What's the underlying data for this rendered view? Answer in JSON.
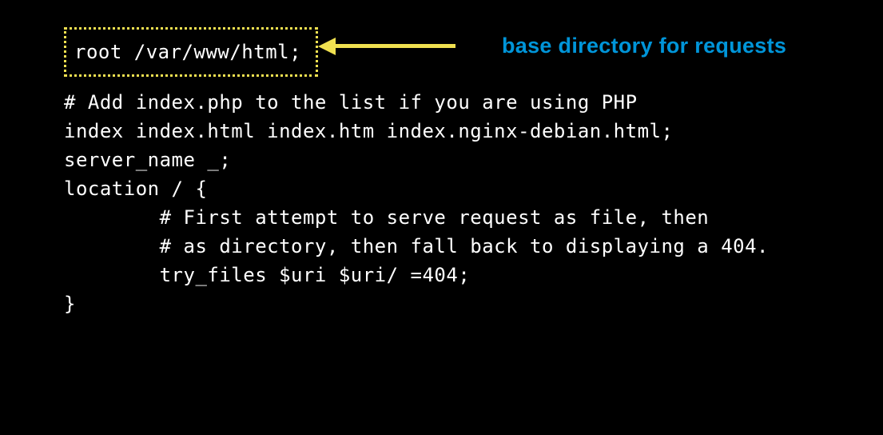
{
  "highlighted": {
    "line": "root /var/www/html;"
  },
  "annotation": {
    "label": "base directory for requests"
  },
  "code": {
    "line1": "# Add index.php to the list if you are using PHP",
    "line2": "index index.html index.htm index.nginx-debian.html;",
    "line3": "",
    "line4": "server_name _;",
    "line5": "",
    "line6": "location / {",
    "line7": "        # First attempt to serve request as file, then",
    "line8": "        # as directory, then fall back to displaying a 404.",
    "line9": "        try_files $uri $uri/ =404;",
    "line10": "}"
  }
}
